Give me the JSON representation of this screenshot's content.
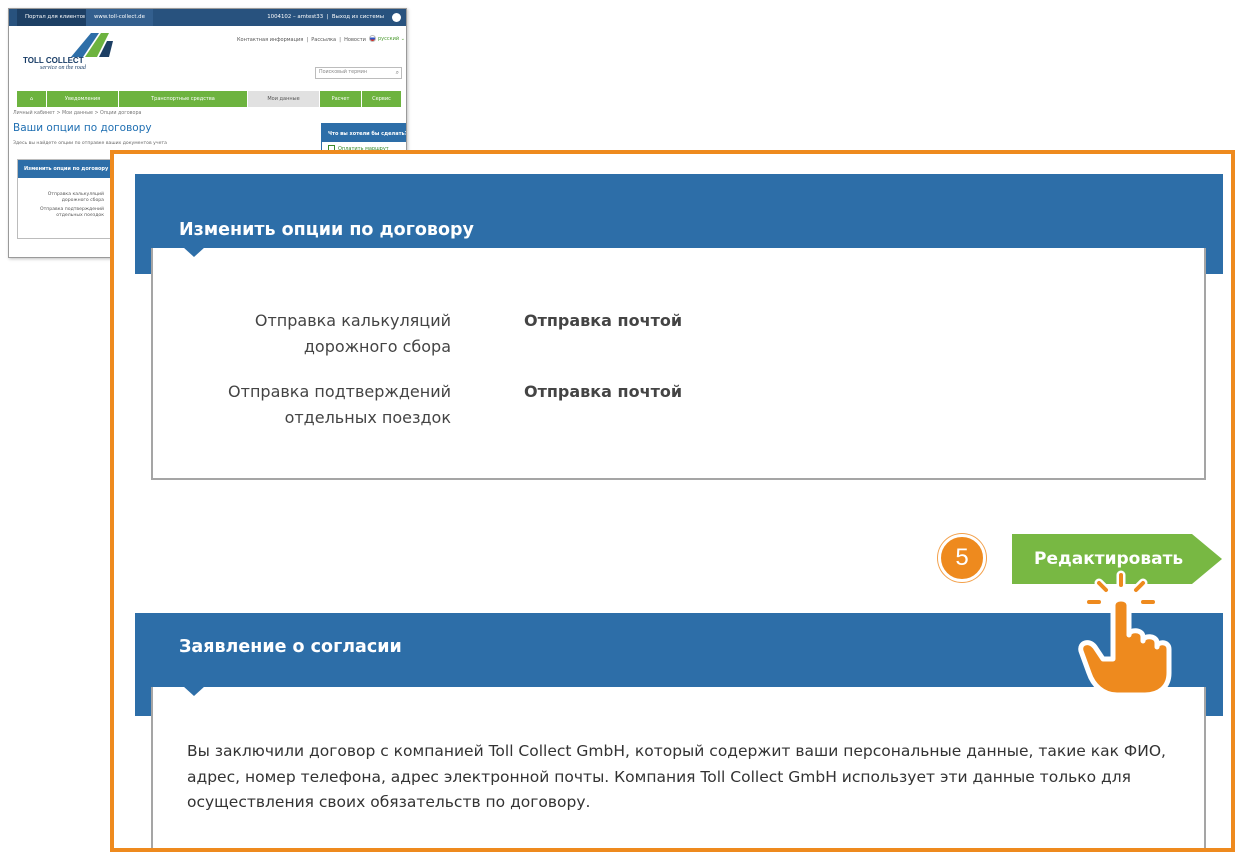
{
  "colors": {
    "accent_orange": "#ee8a1e",
    "header_blue": "#2d6ea8",
    "button_green": "#78b843",
    "nav_green": "#6db33f"
  },
  "thumbnail": {
    "topbar": {
      "portal_tab": "Портал для клиентов",
      "site_tab": "www.toll-collect.de",
      "user": "1004102 – amtest33",
      "logout": "Выход из системы"
    },
    "logo": {
      "name": "TOLL COLLECT",
      "tagline": "service on the road"
    },
    "links": [
      "Контактная информация",
      "Рассылка",
      "Новости"
    ],
    "language": "русский",
    "search_placeholder": "Поисковый термин",
    "nav": [
      {
        "label": "Уведомления"
      },
      {
        "label": "Транспортные средства"
      },
      {
        "label": "Мои данные",
        "active": true
      },
      {
        "label": "Расчет"
      },
      {
        "label": "Сервис"
      }
    ],
    "breadcrumb": "Личный кабинет > Мои данные > Опции договора",
    "page_title": "Ваши опции по договору",
    "subtitle": "Здесь вы найдете опции по отправке ваших документов учета",
    "sidebar": {
      "title": "Что вы хотели бы сделать?",
      "item": "Оплатить маршрут"
    },
    "box": {
      "title": "Изменить опции по договору",
      "line1a": "Отправка калькуляций",
      "line1b": "дорожного сбора",
      "line2a": "Отправка подтверждений",
      "line2b": "отдельных поездок"
    }
  },
  "zoom": {
    "section1": {
      "title": "Изменить опции по договору",
      "rows": [
        {
          "label_line1": "Отправка калькуляций",
          "label_line2": "дорожного сбора",
          "value": "Отправка почтой"
        },
        {
          "label_line1": "Отправка подтверждений",
          "label_line2": "отдельных поездок",
          "value": "Отправка почтой"
        }
      ]
    },
    "step_number": "5",
    "edit_button": "Редактировать",
    "section2": {
      "title": "Заявление о согласии",
      "text": "Вы заключили договор с компанией Toll Collect GmbH, который содержит ваши персональные данные, такие как ФИО, адрес, номер телефона, адрес электронной почты. Компания Toll Collect GmbH использует эти данные только для осуществления своих обязательств по договору."
    }
  }
}
